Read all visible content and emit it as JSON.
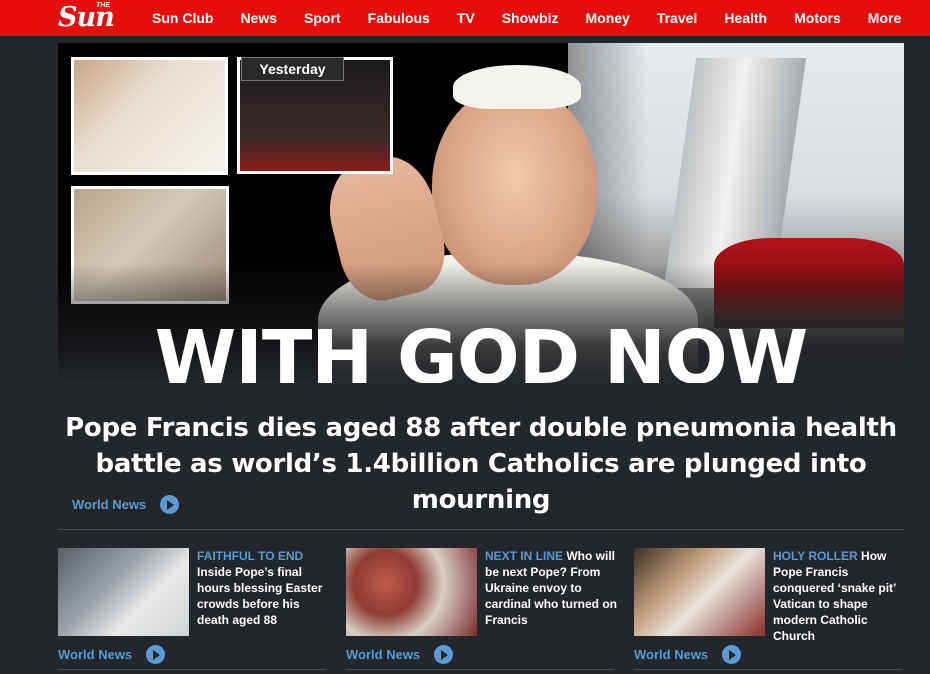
{
  "nav": {
    "logo_small": "THE",
    "logo": "Sun",
    "links": [
      "Sun Club",
      "News",
      "Sport",
      "Fabulous",
      "TV",
      "Showbiz",
      "Money",
      "Travel",
      "Health",
      "Motors",
      "More"
    ]
  },
  "hero": {
    "badge": "Yesterday",
    "headline": "WITH GOD NOW",
    "subheadline": "Pope Francis dies aged 88 after double pneumonia health battle as world’s 1.4billion Catholics are plunged into mourning",
    "section": "World News"
  },
  "cards": [
    {
      "kicker": "FAITHFUL TO END",
      "text": "Inside Pope’s final hours blessing Easter crowds before his death aged 88",
      "section": "World News"
    },
    {
      "kicker": "NEXT IN LINE",
      "text": "Who will be next Pope? From Ukraine envoy to cardinal who turned on Francis",
      "section": "World News"
    },
    {
      "kicker": "HOLY ROLLER",
      "text": "How Pope Francis conquered ‘snake pit’ Vatican to shape modern Catholic Church",
      "section": "World News"
    }
  ],
  "colors": {
    "brand_red": "#e60d0d",
    "background": "#23262a",
    "accent_blue": "#5b9bd5"
  }
}
